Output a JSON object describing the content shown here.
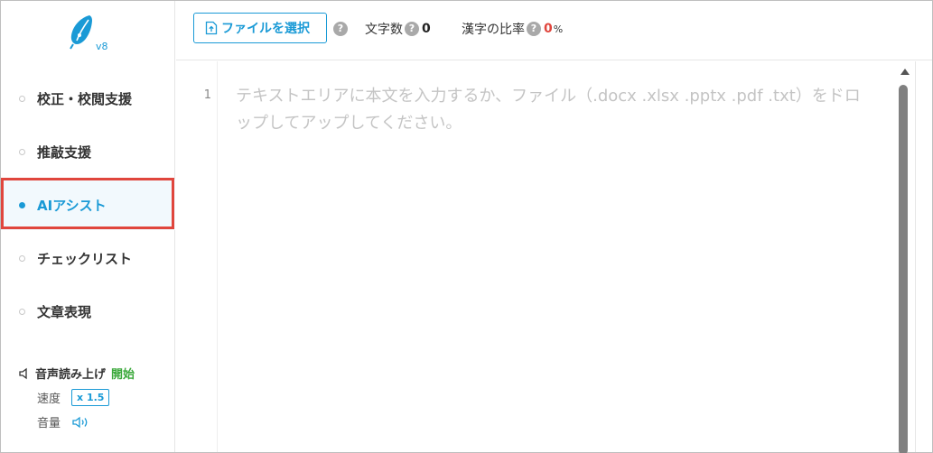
{
  "app": {
    "version": "v8"
  },
  "sidebar": {
    "items": [
      {
        "label": "校正・校閲支援",
        "active": false
      },
      {
        "label": "推敲支援",
        "active": false
      },
      {
        "label": "AIアシスト",
        "active": true
      },
      {
        "label": "チェックリスト",
        "active": false
      },
      {
        "label": "文章表現",
        "active": false
      }
    ],
    "voice": {
      "title": "音声読み上げ",
      "start_label": "開始",
      "speed_label": "速度",
      "speed_value": "x 1.5",
      "volume_label": "音量"
    }
  },
  "toolbar": {
    "file_button_label": "ファイルを選択",
    "char_count_label": "文字数",
    "char_count_value": "0",
    "kanji_ratio_label": "漢字の比率",
    "kanji_ratio_value": "0",
    "kanji_ratio_unit": "%",
    "help_glyph": "?"
  },
  "editor": {
    "line_number": "1",
    "placeholder": "テキストエリアに本文を入力するか、ファイル（.docx .xlsx .pptx .pdf .txt）をドロップしてアップしてください。"
  },
  "colors": {
    "accent": "#1a9ad6",
    "highlight_border": "#e0463d",
    "start_green": "#3aa83a",
    "ratio_red": "#e0463d"
  },
  "icons": [
    "pen-nib-logo-icon",
    "upload-file-icon",
    "help-icon",
    "speaker-icon",
    "volume-icon",
    "scroll-up-arrow-icon"
  ]
}
